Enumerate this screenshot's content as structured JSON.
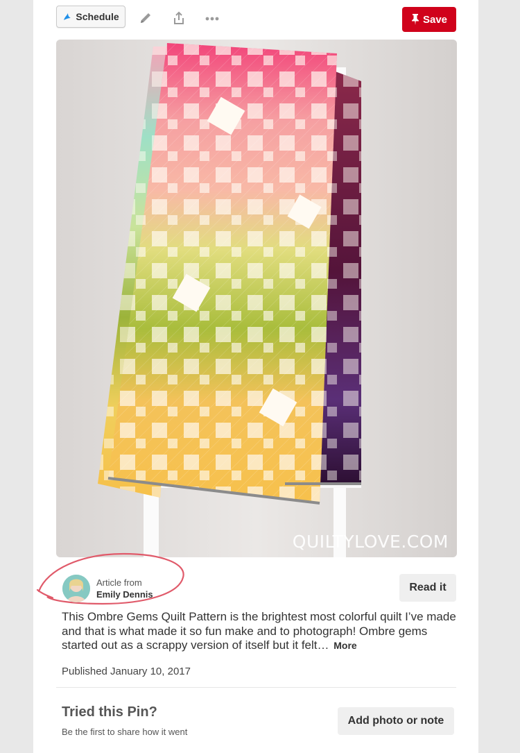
{
  "toolbar": {
    "schedule_label": "Schedule",
    "edit_icon": "pencil-icon",
    "share_icon": "share-icon",
    "more_icon": "more-dots-icon",
    "save_label": "Save",
    "save_color": "#d0021b"
  },
  "pin": {
    "watermark": "QUILTYLOVE.COM"
  },
  "article": {
    "label": "Article from",
    "author": "Emily Dennis",
    "read_label": "Read it"
  },
  "description": {
    "text": "This Ombre Gems Quilt Pattern is the brightest most colorful quilt I’ve made and that is what made it so fun make and to photograph! Ombre gems started out as a scrappy version of itself but it felt…",
    "more_label": "More"
  },
  "published": "Published January 10, 2017",
  "tried": {
    "title": "Tried this Pin?",
    "subtitle": "Be the first to share how it went",
    "add_label": "Add photo or note"
  }
}
